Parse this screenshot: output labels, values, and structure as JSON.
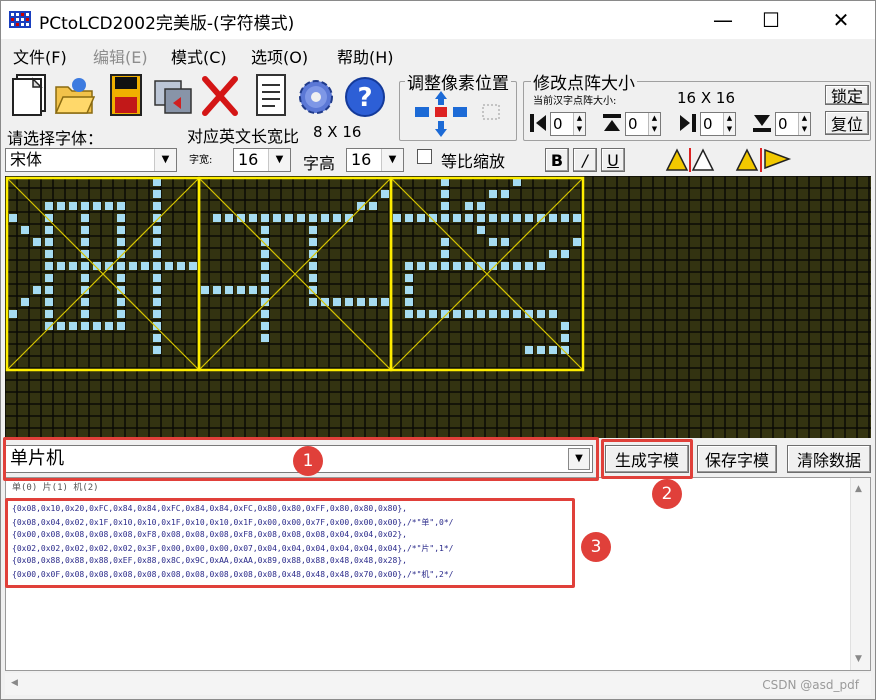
{
  "window": {
    "title": "PCtoLCD2002完美版-(字符模式)",
    "minimize": "—",
    "maximize": "☐",
    "close": "✕"
  },
  "menu": [
    "文件(F)",
    "编辑(E)",
    "模式(C)",
    "选项(O)",
    "帮助(H)"
  ],
  "toolbar_icons": [
    "new-file",
    "open-folder",
    "save-disk",
    "convert",
    "delete-x",
    "notepad",
    "settings-gear",
    "help"
  ],
  "font_panel": {
    "select_font_label": "请选择字体：",
    "font_value": "宋体",
    "ratio_label": "对应英文长宽比",
    "ratio_value": "8 X 16",
    "width_label": "字宽:",
    "width_value": "16",
    "height_label": "字高",
    "height_value": "16",
    "proportional_label": "等比缩放",
    "bold": "B",
    "italic": "/",
    "underline": "U"
  },
  "pixel_panel": {
    "title": "调整像素位置"
  },
  "size_panel": {
    "title": "修改点阵大小",
    "current_label": "当前汉字点阵大小:",
    "current_value": "16 X 16",
    "lock_button": "锁定",
    "reset_button": "复位",
    "spin_values": [
      "0",
      "0",
      "0",
      "0"
    ]
  },
  "canvas": {
    "background": "#333311",
    "grid_line": "#0a0a06",
    "pixel_on": "#a6dcf2",
    "frame": "#ffee00",
    "diagonal": "#d6c400",
    "glyph_chars": [
      "单",
      "片",
      "机"
    ]
  },
  "input": {
    "text": "单片机"
  },
  "buttons": {
    "generate": "生成字模",
    "save": "保存字模",
    "clear": "清除数据"
  },
  "annotations": [
    "1",
    "2",
    "3"
  ],
  "output": {
    "header": "单(0) 片(1) 机(2)",
    "lines": [
      "{0x08,0x10,0x20,0xFC,0x84,0x84,0xFC,0x84,0x84,0xFC,0x80,0x80,0xFF,0x80,0x80,0x80},",
      "{0x08,0x04,0x02,0x1F,0x10,0x10,0x1F,0x10,0x10,0x1F,0x00,0x00,0x7F,0x00,0x00,0x00},/*\"单\",0*/",
      "{0x00,0x08,0x08,0x08,0x08,0xF8,0x08,0x08,0x08,0xF8,0x08,0x08,0x08,0x04,0x04,0x02},",
      "{0x02,0x02,0x02,0x02,0x02,0x3F,0x00,0x00,0x00,0x07,0x04,0x04,0x04,0x04,0x04,0x04},/*\"片\",1*/",
      "{0x08,0x88,0x88,0x88,0xEF,0x88,0x8C,0x9C,0xAA,0xAA,0x89,0x88,0x88,0x48,0x48,0x28},",
      "{0x00,0x0F,0x08,0x08,0x08,0x08,0x08,0x08,0x08,0x08,0x08,0x48,0x48,0x48,0x70,0x00},/*\"机\",2*/"
    ]
  },
  "watermark": "CSDN @asd_pdf"
}
